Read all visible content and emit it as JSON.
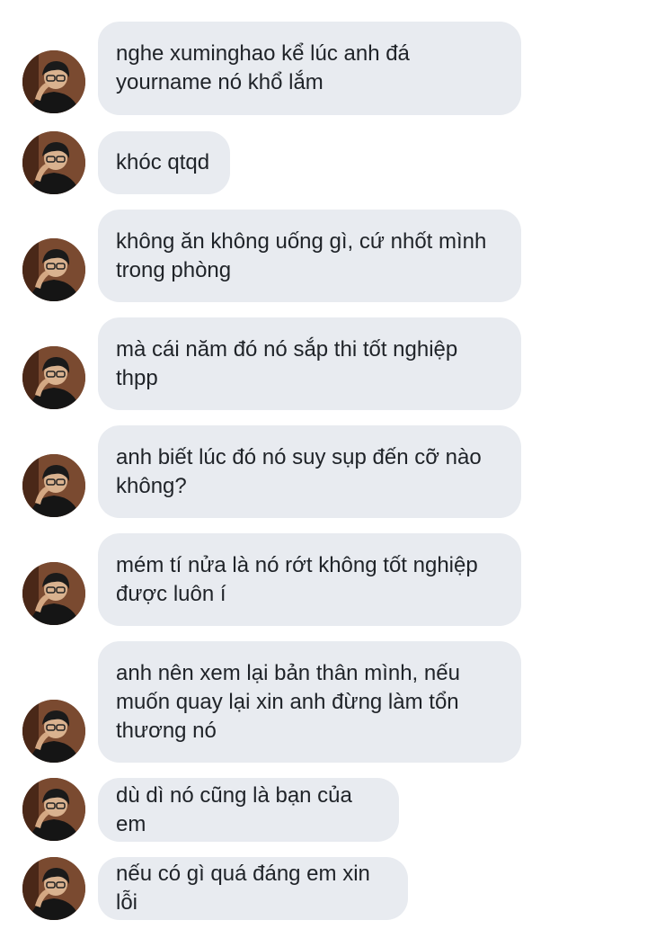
{
  "messages": [
    {
      "text": "nghe xuminghao kể lúc anh đá yourname nó khổ lắm"
    },
    {
      "text": "khóc qtqd"
    },
    {
      "text": "không ăn không uống gì, cứ nhốt mình trong phòng"
    },
    {
      "text": "mà cái năm đó nó sắp thi tốt nghiệp thpp"
    },
    {
      "text": "anh biết lúc đó nó suy sụp đến cỡ nào không?"
    },
    {
      "text": "mém tí nửa là nó rớt không tốt nghiệp được luôn í"
    },
    {
      "text": "anh nên xem lại bản thân mình, nếu muốn quay lại xin anh đừng làm tổn thương nó"
    },
    {
      "text": "dù dì nó cũng là bạn của em"
    },
    {
      "text": "nếu có gì quá đáng em xin lỗi"
    }
  ],
  "colors": {
    "bubble_bg": "#e8ebf0",
    "text": "#1f2328",
    "avatar_bg": "#6b3d28"
  },
  "icons": {
    "avatar": "sender-avatar-photo"
  }
}
